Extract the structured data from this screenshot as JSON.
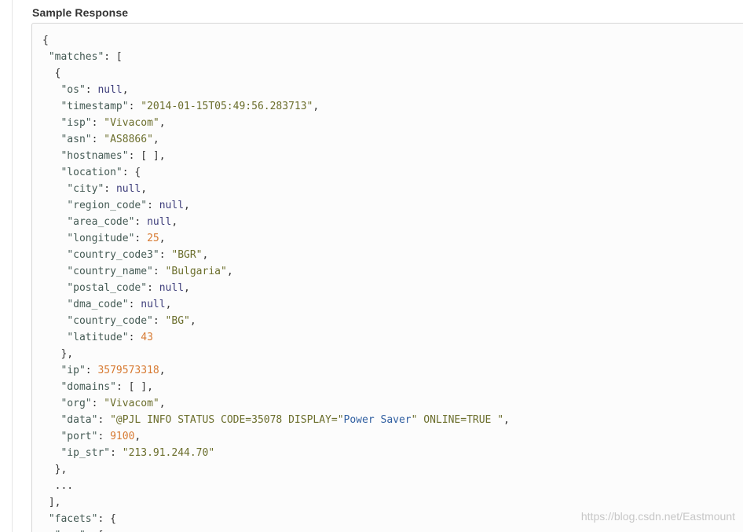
{
  "section": {
    "title": "Sample Response"
  },
  "colors": {
    "key": "#445a54",
    "string": "#6b6e2c",
    "null": "#3d3d7a",
    "number": "#d77a32",
    "punctuation": "#333333",
    "highlight": "#2f5ea0"
  },
  "code_lines": [
    [
      {
        "t": "p",
        "v": "{"
      }
    ],
    [
      {
        "t": "p",
        "v": " "
      },
      {
        "t": "k",
        "v": "\"matches\""
      },
      {
        "t": "p",
        "v": ": ["
      }
    ],
    [
      {
        "t": "p",
        "v": "  {"
      }
    ],
    [
      {
        "t": "p",
        "v": "   "
      },
      {
        "t": "k",
        "v": "\"os\""
      },
      {
        "t": "p",
        "v": ": "
      },
      {
        "t": "n",
        "v": "null"
      },
      {
        "t": "p",
        "v": ","
      }
    ],
    [
      {
        "t": "p",
        "v": "   "
      },
      {
        "t": "k",
        "v": "\"timestamp\""
      },
      {
        "t": "p",
        "v": ": "
      },
      {
        "t": "s",
        "v": "\"2014-01-15T05:49:56.283713\""
      },
      {
        "t": "p",
        "v": ","
      }
    ],
    [
      {
        "t": "p",
        "v": "   "
      },
      {
        "t": "k",
        "v": "\"isp\""
      },
      {
        "t": "p",
        "v": ": "
      },
      {
        "t": "s",
        "v": "\"Vivacom\""
      },
      {
        "t": "p",
        "v": ","
      }
    ],
    [
      {
        "t": "p",
        "v": "   "
      },
      {
        "t": "k",
        "v": "\"asn\""
      },
      {
        "t": "p",
        "v": ": "
      },
      {
        "t": "s",
        "v": "\"AS8866\""
      },
      {
        "t": "p",
        "v": ","
      }
    ],
    [
      {
        "t": "p",
        "v": "   "
      },
      {
        "t": "k",
        "v": "\"hostnames\""
      },
      {
        "t": "p",
        "v": ": [ ],"
      }
    ],
    [
      {
        "t": "p",
        "v": "   "
      },
      {
        "t": "k",
        "v": "\"location\""
      },
      {
        "t": "p",
        "v": ": {"
      }
    ],
    [
      {
        "t": "p",
        "v": "    "
      },
      {
        "t": "k",
        "v": "\"city\""
      },
      {
        "t": "p",
        "v": ": "
      },
      {
        "t": "n",
        "v": "null"
      },
      {
        "t": "p",
        "v": ","
      }
    ],
    [
      {
        "t": "p",
        "v": "    "
      },
      {
        "t": "k",
        "v": "\"region_code\""
      },
      {
        "t": "p",
        "v": ": "
      },
      {
        "t": "n",
        "v": "null"
      },
      {
        "t": "p",
        "v": ","
      }
    ],
    [
      {
        "t": "p",
        "v": "    "
      },
      {
        "t": "k",
        "v": "\"area_code\""
      },
      {
        "t": "p",
        "v": ": "
      },
      {
        "t": "n",
        "v": "null"
      },
      {
        "t": "p",
        "v": ","
      }
    ],
    [
      {
        "t": "p",
        "v": "    "
      },
      {
        "t": "k",
        "v": "\"longitude\""
      },
      {
        "t": "p",
        "v": ": "
      },
      {
        "t": "num",
        "v": "25"
      },
      {
        "t": "p",
        "v": ","
      }
    ],
    [
      {
        "t": "p",
        "v": "    "
      },
      {
        "t": "k",
        "v": "\"country_code3\""
      },
      {
        "t": "p",
        "v": ": "
      },
      {
        "t": "s",
        "v": "\"BGR\""
      },
      {
        "t": "p",
        "v": ","
      }
    ],
    [
      {
        "t": "p",
        "v": "    "
      },
      {
        "t": "k",
        "v": "\"country_name\""
      },
      {
        "t": "p",
        "v": ": "
      },
      {
        "t": "s",
        "v": "\"Bulgaria\""
      },
      {
        "t": "p",
        "v": ","
      }
    ],
    [
      {
        "t": "p",
        "v": "    "
      },
      {
        "t": "k",
        "v": "\"postal_code\""
      },
      {
        "t": "p",
        "v": ": "
      },
      {
        "t": "n",
        "v": "null"
      },
      {
        "t": "p",
        "v": ","
      }
    ],
    [
      {
        "t": "p",
        "v": "    "
      },
      {
        "t": "k",
        "v": "\"dma_code\""
      },
      {
        "t": "p",
        "v": ": "
      },
      {
        "t": "n",
        "v": "null"
      },
      {
        "t": "p",
        "v": ","
      }
    ],
    [
      {
        "t": "p",
        "v": "    "
      },
      {
        "t": "k",
        "v": "\"country_code\""
      },
      {
        "t": "p",
        "v": ": "
      },
      {
        "t": "s",
        "v": "\"BG\""
      },
      {
        "t": "p",
        "v": ","
      }
    ],
    [
      {
        "t": "p",
        "v": "    "
      },
      {
        "t": "k",
        "v": "\"latitude\""
      },
      {
        "t": "p",
        "v": ": "
      },
      {
        "t": "num",
        "v": "43"
      }
    ],
    [
      {
        "t": "p",
        "v": "   },"
      }
    ],
    [
      {
        "t": "p",
        "v": "   "
      },
      {
        "t": "k",
        "v": "\"ip\""
      },
      {
        "t": "p",
        "v": ": "
      },
      {
        "t": "num",
        "v": "3579573318"
      },
      {
        "t": "p",
        "v": ","
      }
    ],
    [
      {
        "t": "p",
        "v": "   "
      },
      {
        "t": "k",
        "v": "\"domains\""
      },
      {
        "t": "p",
        "v": ": [ ],"
      }
    ],
    [
      {
        "t": "p",
        "v": "   "
      },
      {
        "t": "k",
        "v": "\"org\""
      },
      {
        "t": "p",
        "v": ": "
      },
      {
        "t": "s",
        "v": "\"Vivacom\""
      },
      {
        "t": "p",
        "v": ","
      }
    ],
    [
      {
        "t": "p",
        "v": "   "
      },
      {
        "t": "k",
        "v": "\"data\""
      },
      {
        "t": "p",
        "v": ": "
      },
      {
        "t": "s",
        "v": "\"@PJL INFO STATUS CODE=35078 DISPLAY=\""
      },
      {
        "t": "hl",
        "v": "Power Saver"
      },
      {
        "t": "s",
        "v": "\" ONLINE=TRUE \""
      },
      {
        "t": "p",
        "v": ","
      }
    ],
    [
      {
        "t": "p",
        "v": "   "
      },
      {
        "t": "k",
        "v": "\"port\""
      },
      {
        "t": "p",
        "v": ": "
      },
      {
        "t": "num",
        "v": "9100"
      },
      {
        "t": "p",
        "v": ","
      }
    ],
    [
      {
        "t": "p",
        "v": "   "
      },
      {
        "t": "k",
        "v": "\"ip_str\""
      },
      {
        "t": "p",
        "v": ": "
      },
      {
        "t": "s",
        "v": "\"213.91.244.70\""
      }
    ],
    [
      {
        "t": "p",
        "v": "  },"
      }
    ],
    [
      {
        "t": "p",
        "v": "  ..."
      }
    ],
    [
      {
        "t": "p",
        "v": " ],"
      }
    ],
    [
      {
        "t": "p",
        "v": " "
      },
      {
        "t": "k",
        "v": "\"facets\""
      },
      {
        "t": "p",
        "v": ": {"
      }
    ],
    [
      {
        "t": "p",
        "v": "  "
      },
      {
        "t": "k",
        "v": "\"org\""
      },
      {
        "t": "p",
        "v": ": ["
      }
    ]
  ],
  "watermark": "https://blog.csdn.net/Eastmount"
}
